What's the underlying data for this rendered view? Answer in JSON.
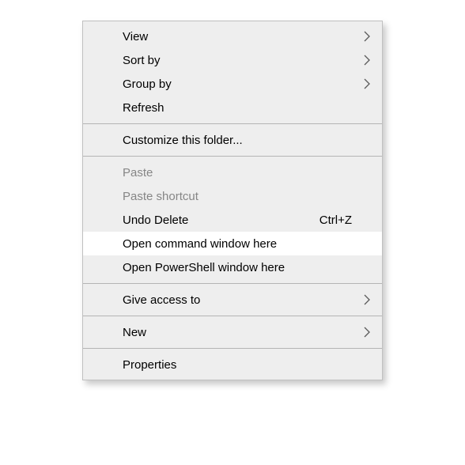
{
  "menu": {
    "items": [
      {
        "label": "View",
        "has_submenu": true
      },
      {
        "label": "Sort by",
        "has_submenu": true
      },
      {
        "label": "Group by",
        "has_submenu": true
      },
      {
        "label": "Refresh"
      },
      {
        "label": "Customize this folder..."
      },
      {
        "label": "Paste",
        "disabled": true
      },
      {
        "label": "Paste shortcut",
        "disabled": true
      },
      {
        "label": "Undo Delete",
        "shortcut": "Ctrl+Z"
      },
      {
        "label": "Open command window here",
        "highlight": true
      },
      {
        "label": "Open PowerShell window here"
      },
      {
        "label": "Give access to",
        "has_submenu": true
      },
      {
        "label": "New",
        "has_submenu": true
      },
      {
        "label": "Properties"
      }
    ]
  }
}
